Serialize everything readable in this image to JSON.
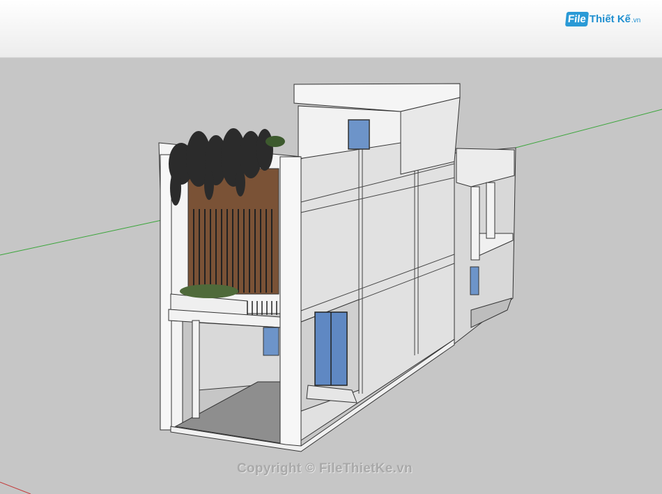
{
  "header": {
    "logo": {
      "file_label": "File",
      "rest_label": "Thiết Kế",
      "tld_label": ".vn"
    }
  },
  "viewport": {
    "watermark": "Copyright © FileThietKe.vn",
    "axis_colors": {
      "green": "#3aa53a",
      "red": "#c43a3a"
    },
    "background": "#c6c6c6"
  }
}
